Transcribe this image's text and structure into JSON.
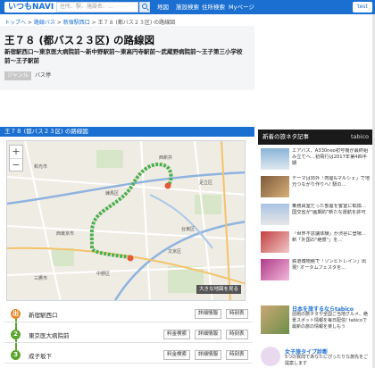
{
  "header": {
    "logo": "いつもNAVI",
    "search_placeholder": "住所、駅、施設名、…",
    "nav": [
      "地図",
      "施設検索",
      "住所検索",
      "Myページ"
    ],
    "user_label": "test"
  },
  "breadcrumb": [
    "トップへ",
    "路線バス",
    "新宿駅西口",
    "王７８ (都バス２３区) の路線図"
  ],
  "page": {
    "title": "王７８ (都バス２３区) の路線図",
    "subtitle": "新宿駅西口〜東京医大病院前〜新中野駅前〜東高円寺駅前〜武蔵野病院前〜王子第三小学校前〜王子駅前",
    "genre_tag": "ジャンル",
    "genre_value": "バス停"
  },
  "map_section": {
    "heading": "王７８ (都バス２３区) の路線図",
    "zoom_in": "+",
    "zoom_out": "−",
    "big_map_button": "大きな地図を見る"
  },
  "stops": [
    {
      "icon": "出",
      "name": "新宿駅西口",
      "buttons": [
        "詳細情報",
        "時刻表"
      ],
      "color": "#e8862a"
    },
    {
      "icon": "2",
      "name": "東京医大病院前",
      "buttons": [
        "料金検索",
        "詳細情報",
        "時刻表"
      ],
      "color": "#5aa52d"
    },
    {
      "icon": "3",
      "name": "成子坂下",
      "buttons": [
        "料金検索",
        "詳細情報",
        "時刻表"
      ],
      "color": "#5aa52d"
    }
  ],
  "sidebar": {
    "heading": "新着の旅ネタ記事",
    "brand": "tabico",
    "articles": [
      "エアバス、A330neo初号機が最終組み立てへ…初飛行は2017年第4四半期",
      "テーマは郊外「肉屋&マルシェ」で地元つながり作りへ! 駅の…",
      "乗務員室だった部屋を客室に転換…国交省が\"画期的\"新たな運航を許可",
      "「世界不思議体験」が渋谷に登場…新「外国の\"絶景\"」を…",
      "鉄道博物館で「ゾンビトレイン」出現! オータムフェスタを…"
    ],
    "banner_title": "日本を旅するならtabico",
    "banner_text": "話題の旅ネタや全国ご当地グルメ、絶景スポット情報を毎日配信! tabicoで最新の旅の情報を楽しもう",
    "banner2_title": "女子旅タイプ診断",
    "banner2_text": "5つの質問であなたにぴったりな旅先をご提案します"
  },
  "colors": {
    "brand": "#1a6fd1",
    "route": "#5aa52d",
    "start": "#e8862a"
  }
}
